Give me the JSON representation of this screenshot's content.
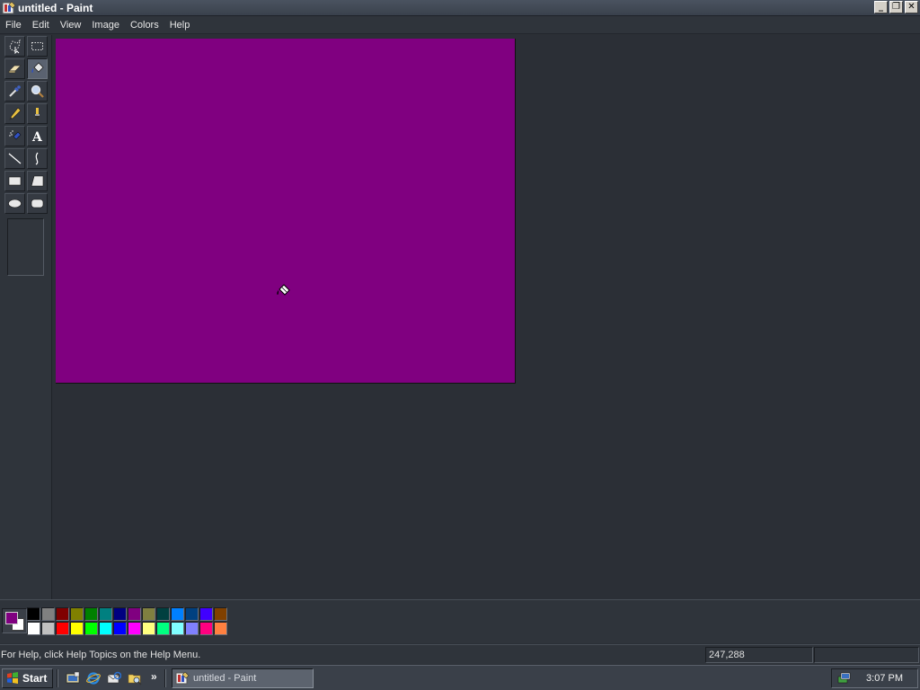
{
  "window": {
    "title": "untitled - Paint",
    "controls": [
      "minimize",
      "restore",
      "close"
    ]
  },
  "menu": {
    "items": [
      "File",
      "Edit",
      "View",
      "Image",
      "Colors",
      "Help"
    ]
  },
  "toolbox": {
    "tools": [
      {
        "name": "free-form-select",
        "icon": "free-select-icon",
        "active": false
      },
      {
        "name": "select",
        "icon": "rect-select-icon",
        "active": false
      },
      {
        "name": "eraser",
        "icon": "eraser-icon",
        "active": false
      },
      {
        "name": "fill-with-color",
        "icon": "paint-bucket-icon",
        "active": true
      },
      {
        "name": "pick-color",
        "icon": "eyedropper-icon",
        "active": false
      },
      {
        "name": "magnifier",
        "icon": "magnifier-icon",
        "active": false
      },
      {
        "name": "pencil",
        "icon": "pencil-icon",
        "active": false
      },
      {
        "name": "brush",
        "icon": "brush-icon",
        "active": false
      },
      {
        "name": "airbrush",
        "icon": "airbrush-icon",
        "active": false
      },
      {
        "name": "text",
        "icon": "text-icon",
        "active": false,
        "glyph": "A"
      },
      {
        "name": "line",
        "icon": "line-icon",
        "active": false
      },
      {
        "name": "curve",
        "icon": "curve-icon",
        "active": false
      },
      {
        "name": "rectangle",
        "icon": "rectangle-icon",
        "active": false
      },
      {
        "name": "polygon",
        "icon": "polygon-icon",
        "active": false
      },
      {
        "name": "ellipse",
        "icon": "ellipse-icon",
        "active": false
      },
      {
        "name": "rounded-rectangle",
        "icon": "rounded-rect-icon",
        "active": false
      }
    ]
  },
  "canvas": {
    "fill_color": "#800080"
  },
  "colors": {
    "foreground": "#800080",
    "background": "#ffffff",
    "palette_top": [
      "#000000",
      "#808080",
      "#800000",
      "#808000",
      "#008000",
      "#008080",
      "#000080",
      "#800080",
      "#808040",
      "#004040",
      "#0080ff",
      "#004080",
      "#4000ff",
      "#804000"
    ],
    "palette_bottom": [
      "#ffffff",
      "#c0c0c0",
      "#ff0000",
      "#ffff00",
      "#00ff00",
      "#00ffff",
      "#0000ff",
      "#ff00ff",
      "#ffff80",
      "#00ff80",
      "#80ffff",
      "#8080ff",
      "#ff0080",
      "#ff8040"
    ]
  },
  "status": {
    "help_text": "For Help, click Help Topics on the Help Menu.",
    "coordinates": "247,288",
    "size": ""
  },
  "taskbar": {
    "start_label": "Start",
    "quick_launch": [
      "show-desktop-icon",
      "internet-explorer-icon",
      "outlook-express-icon",
      "windows-explorer-icon"
    ],
    "chevron": "»",
    "task_label": "untitled - Paint",
    "clock": "3:07 PM"
  }
}
